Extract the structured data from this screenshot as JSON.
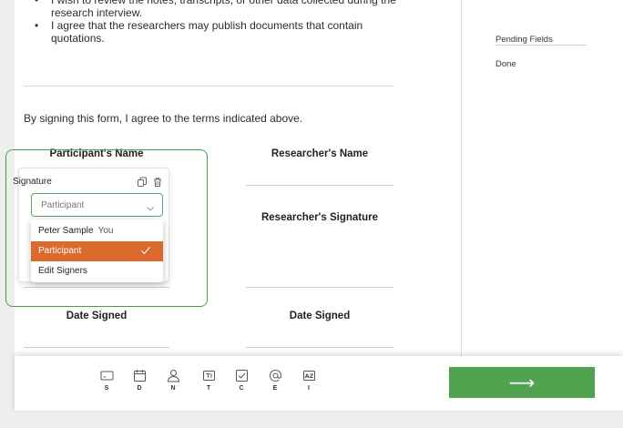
{
  "document": {
    "bullets": [
      "I wish to review the notes, transcripts, or other data collected during the research interview.",
      "I agree that the researchers may publish documents that contain quotations."
    ],
    "agree_text": "By signing this form, I agree to the terms indicated above.",
    "participant_name_label": "Participant's Name",
    "researcher_name_label": "Researcher's Name",
    "researcher_signature_label": "Researcher's Signature",
    "date_signed_left": "Date Signed",
    "date_signed_right": "Date Signed"
  },
  "signature_popup": {
    "title": "Signature",
    "select_value": "Participant",
    "menu": [
      {
        "name": "Peter Sample",
        "tag": "You"
      },
      {
        "name": "Participant",
        "selected": true
      },
      {
        "name": "Edit Signers"
      }
    ],
    "accent_color": "#dc6a2c",
    "highlight_color": "#3fa34d"
  },
  "sidebar": {
    "pending_label": "Pending Fields",
    "done_label": "Done"
  },
  "toolbar": {
    "tools": [
      {
        "label": "S",
        "icon": "signature-icon"
      },
      {
        "label": "D",
        "icon": "calendar-icon"
      },
      {
        "label": "N",
        "icon": "person-icon"
      },
      {
        "label": "T",
        "icon": "text-icon"
      },
      {
        "label": "C",
        "icon": "checkbox-icon"
      },
      {
        "label": "E",
        "icon": "at-icon"
      },
      {
        "label": "I",
        "icon": "initials-icon"
      }
    ],
    "next_arrow": "⟶",
    "next_color": "#52a34f"
  }
}
